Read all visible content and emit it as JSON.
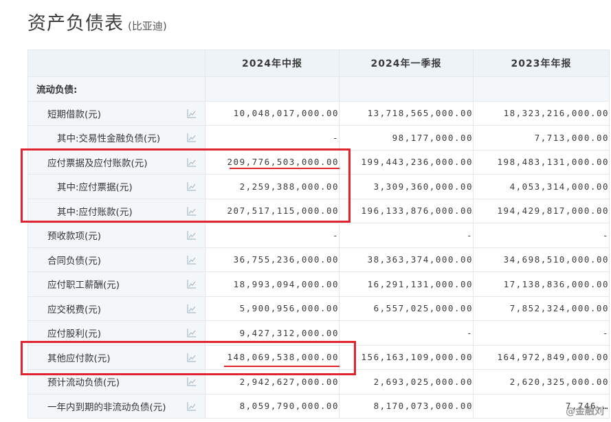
{
  "page": {
    "title": "资产负债表",
    "subtitle": "(比亚迪)"
  },
  "table": {
    "columns": [
      "",
      "2024年中报",
      "2024年一季报",
      "2023年年报"
    ],
    "section_label": "流动负债:",
    "rows": [
      {
        "label": "短期借款(元)",
        "indent": 1,
        "values": [
          "10,048,017,000.00",
          "13,718,565,000.00",
          "18,323,216,000.00"
        ]
      },
      {
        "label": "其中:交易性金融负债(元)",
        "indent": 2,
        "values": [
          "-",
          "98,177,000.00",
          "7,713,000.00"
        ]
      },
      {
        "label": "应付票据及应付账款(元)",
        "indent": 1,
        "values": [
          "209,776,503,000.00",
          "199,443,236,000.00",
          "198,483,131,000.00"
        ]
      },
      {
        "label": "其中:应付票据(元)",
        "indent": 2,
        "values": [
          "2,259,388,000.00",
          "3,309,360,000.00",
          "4,053,314,000.00"
        ]
      },
      {
        "label": "其中:应付账款(元)",
        "indent": 2,
        "values": [
          "207,517,115,000.00",
          "196,133,876,000.00",
          "194,429,817,000.00"
        ]
      },
      {
        "label": "预收款项(元)",
        "indent": 1,
        "values": [
          "-",
          "-",
          "-"
        ]
      },
      {
        "label": "合同负债(元)",
        "indent": 1,
        "values": [
          "36,755,236,000.00",
          "38,363,374,000.00",
          "34,698,510,000.00"
        ]
      },
      {
        "label": "应付职工薪酬(元)",
        "indent": 1,
        "values": [
          "18,993,094,000.00",
          "16,291,131,000.00",
          "17,138,836,000.00"
        ]
      },
      {
        "label": "应交税费(元)",
        "indent": 1,
        "values": [
          "5,900,956,000.00",
          "6,557,025,000.00",
          "7,852,324,000.00"
        ]
      },
      {
        "label": "应付股利(元)",
        "indent": 1,
        "values": [
          "9,427,312,000.00",
          "-",
          "-"
        ]
      },
      {
        "label": "其他应付款(元)",
        "indent": 1,
        "values": [
          "148,069,538,000.00",
          "156,163,109,000.00",
          "164,972,849,000.00"
        ]
      },
      {
        "label": "预计流动负债(元)",
        "indent": 1,
        "values": [
          "2,942,627,000.00",
          "2,693,025,000.00",
          "2,620,325,000.00"
        ]
      },
      {
        "label": "一年内到期的非流动负债(元)",
        "indent": 1,
        "values": [
          "8,059,790,000.00",
          "8,170,073,000.00",
          "7,746,…"
        ]
      }
    ]
  },
  "annotations": {
    "box_color": "#e0232d"
  },
  "watermark": "@金融刘"
}
